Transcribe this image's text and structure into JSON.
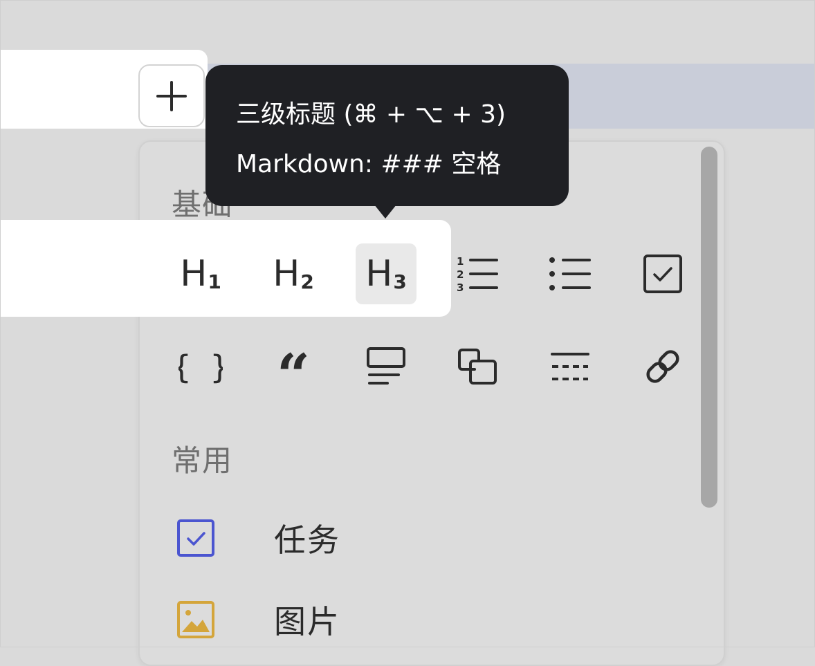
{
  "tooltip": {
    "line1": "三级标题 (⌘ + ⌥ + 3)",
    "line2": "Markdown: ### 空格"
  },
  "add_button": {
    "label": "+"
  },
  "menu": {
    "sections": {
      "basic": "基础",
      "common": "常用"
    },
    "headings": [
      {
        "main": "H",
        "sub": "1"
      },
      {
        "main": "H",
        "sub": "2"
      },
      {
        "main": "H",
        "sub": "3"
      }
    ],
    "grid_icons": [
      "heading-1-icon",
      "heading-2-icon",
      "heading-3-icon",
      "ordered-list-icon",
      "bullet-list-icon",
      "checkbox-icon",
      "code-block-icon",
      "quote-icon",
      "callout-icon",
      "sync-block-icon",
      "divider-icon",
      "link-icon"
    ],
    "common_items": [
      {
        "label": "任务",
        "icon": "task-checkbox-icon",
        "color": "#4b55d0"
      },
      {
        "label": "图片",
        "icon": "image-icon",
        "color": "#d4a53b"
      }
    ]
  },
  "colors": {
    "tooltip_bg": "#1f2024",
    "panel_bg": "#dcdcdc",
    "selection": "#c9cdd9"
  }
}
